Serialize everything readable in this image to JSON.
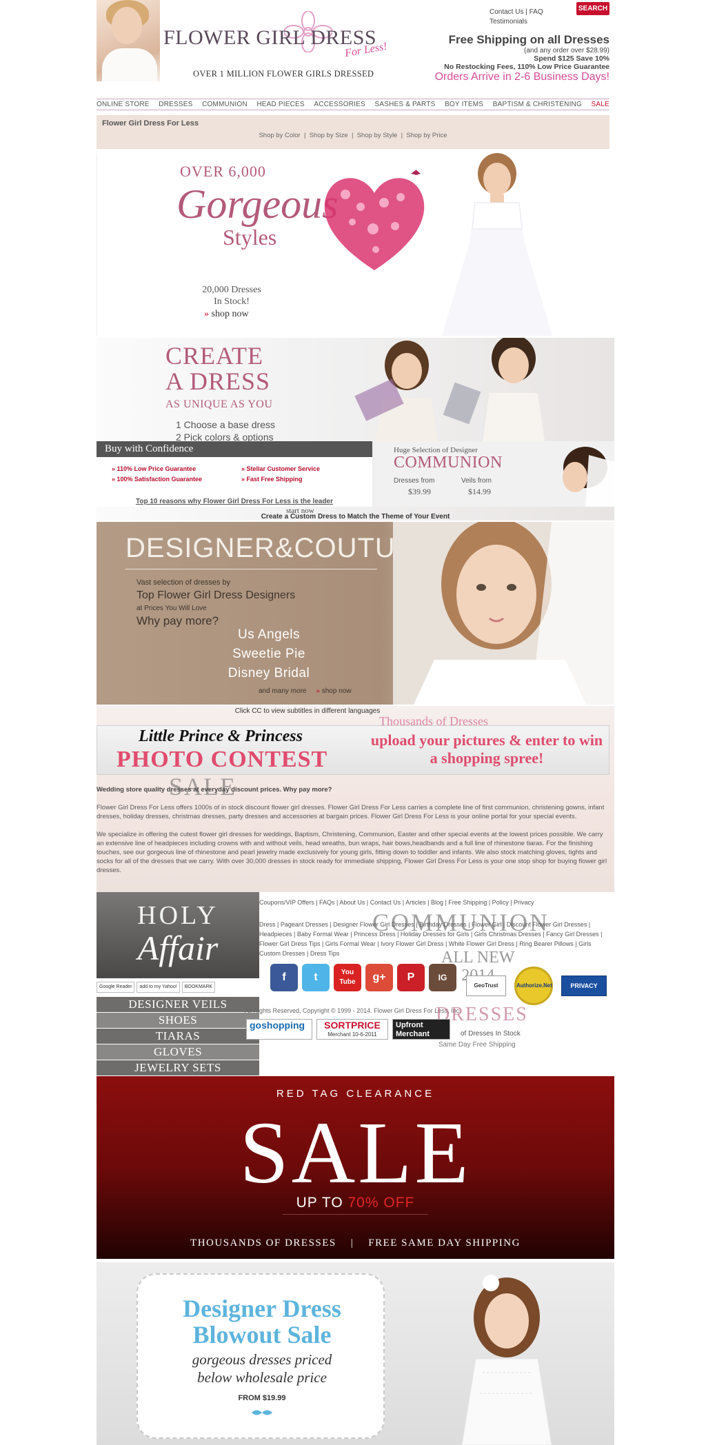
{
  "header": {
    "logo_main": "FLOWER GIRL DRESS",
    "logo_sub": "For Less!",
    "tagline": "OVER 1 MILLION FLOWER GIRLS DRESSED",
    "top_links": [
      "Contact Us",
      "FAQ",
      "Testimonials"
    ],
    "search_label": "SEARCH",
    "promo_line1": "Free Shipping on all Dresses",
    "promo_line2": "(and any order over $28.99)",
    "promo_line3": "Spend $125 Save 10%",
    "promo_line4": "No Restocking Fees, 110% Low Price Guarantee",
    "promo_line5": "Orders Arrive in 2-6 Business Days!"
  },
  "nav": {
    "items": [
      "ONLINE STORE",
      "DRESSES",
      "COMMUNION",
      "HEAD PIECES",
      "ACCESSORIES",
      "SASHES & PARTS",
      "BOY ITEMS",
      "BAPTISM & CHRISTENING",
      "SALE"
    ]
  },
  "strip": {
    "title": "Flower Girl Dress For Less",
    "links": [
      "Shop by Color",
      "Shop by Size",
      "Shop by Style",
      "Shop by Price"
    ]
  },
  "banner_styles": {
    "over": "OVER 6,000",
    "gorgeous": "Gorgeous",
    "styles": "Styles",
    "stock_line1": "20,000 Dresses",
    "stock_line2": "In Stock!",
    "shop": "shop now"
  },
  "banner_create": {
    "line1": "CREATE",
    "line2": "A DRESS",
    "unique": "AS UNIQUE AS YOU",
    "step1": "1  Choose a base dress",
    "step2": "2  Pick colors & options",
    "start": "start now",
    "caption": "Create a Custom Dress to Match the Theme of Your Event"
  },
  "confidence": {
    "title": "Buy with Confidence",
    "items": [
      "110% Low Price Guarantee",
      "Stellar Customer Service",
      "100% Satisfaction Guarantee",
      "Fast Free Shipping"
    ],
    "top10": "Top 10 reasons why Flower Girl Dress For Less is the leader"
  },
  "communion": {
    "huge": "Huge Selection of Designer",
    "title": "COMMUNION",
    "dresses_label": "Dresses from",
    "dresses_price": "$39.99",
    "veils_label": "Veils from",
    "veils_price": "$14.99"
  },
  "banner_designer": {
    "title": "DESIGNER&COUTURE",
    "vast": "Vast selection of dresses by",
    "top": "Top Flower Girl Dress Designers",
    "prices": "at Prices You Will Love",
    "why": "Why pay more?",
    "brands": [
      "Us Angels",
      "Sweetie Pie",
      "Disney Bridal"
    ],
    "more": "and many more",
    "shop": "shop now"
  },
  "banner_contest": {
    "cc": "Click CC to view subtitles in different languages",
    "thousands": "Thousands of Dresses",
    "lp": "Little Prince & Princess",
    "pc": "PHOTO CONTEST",
    "upload": "upload your pictures & enter to win a shopping spree!",
    "sale_ghost": "SALE"
  },
  "about": {
    "question": "Wedding store quality dresses at everyday discount prices. Why pay more?",
    "para1": "Flower Girl Dress For Less offers 1000s of in stock discount flower girl dresses. Flower Girl Dress For Less carries a complete line of first communion, christening gowns, infant dresses, holiday dresses, christmas dresses, party dresses and accessories at bargain prices. Flower Girl Dress For Less is your online portal for your special events.",
    "para2": "We specialize in offering the cutest flower girl dresses for weddings, Baptism, Christening, Communion, Easter and other special events at the lowest prices possible. We carry an extensive line of headpieces including crowns with and without veils, head wreaths, bun wraps, hair bows,headbands and a full line of rhinestone tiaras. For the finishing touches, see our gorgeous line of rhinestone and pearl jewelry made exclusively for young girls, fitting down to toddler and infants. We also stock matching gloves, tights and socks for all of the dresses that we carry. With over 30,000 dresses in stock ready for immediate shipping, Flower Girl Dress For Less is your one stop shop for buying flower girl dresses."
  },
  "holy": {
    "line1": "HOLY",
    "line2": "Affair",
    "bookmarks": [
      "Google Reader",
      "add to my Yahoo!",
      "BOOKMARK"
    ],
    "menu": [
      "DESIGNER VEILS",
      "SHOES",
      "TIARAS",
      "GLOVES",
      "JEWELRY SETS"
    ]
  },
  "footer": {
    "links1": "Coupons/VIP Offers  |  FAQs  |  About Us  |  Contact Us  |  Articles  |  Blog  |  Free Shipping  |  Policy  |  Privacy",
    "links2": "Dress  |  Pageant Dresses  |  Designer Flower Girl Dresses  |  Birthday Dresses  |  Flower Girl  |  Discount Flower Girl Dresses  |  Headpieces  |  Baby Formal Wear  |  Princess Dress  |  Holiday Dresses for Girls  |  Girls Christmas Dresses  |  Fancy Girl Dresses  |  Flower Girl Dress Tips  |  Girls Formal Wear  |  Ivory Flower Girl Dress  |  White Flower Girl Dress  |  Ring Bearer Pillows  |  Girls Custom Dresses  |  Dress Tips",
    "communion_ghost": "COMMUNION",
    "new_ghost1": "ALL NEW",
    "new_ghost2": "2014",
    "dresses_ghost": "DRESSES",
    "social": [
      "f",
      "t",
      "You Tube",
      "g+",
      "P",
      "IG"
    ],
    "seals": [
      "GeoTrust",
      "Authorize.Net",
      "PRIVACY"
    ],
    "copyright": "All Rights Reserved, Copyright © 1999 - 2014. Flower Girl Dress For Less, Inc.",
    "merchants": [
      "goshopping",
      "SORTPRICE",
      "Upfront Merchant"
    ],
    "merchant_sub": "Merchant 10-6-2011",
    "dresses_stock": "of Dresses In Stock",
    "sameday": "Same Day Free Shipping"
  },
  "sale_banner": {
    "rtc": "RED TAG CLEARANCE",
    "big": "SALE",
    "upto": "UP TO",
    "pct": "70% OFF",
    "bottom": "THOUSANDS OF DRESSES    |    FREE SAME DAY SHIPPING"
  },
  "blowout": {
    "line1": "Designer Dress",
    "line2": "Blowout Sale",
    "line3": "gorgeous dresses priced",
    "line4": "below wholesale price",
    "from": "FROM $19.99"
  },
  "colors": {
    "accent_pink": "#d64a96",
    "mauve": "#b35a7a",
    "sale_red": "#c8102e",
    "sky": "#5db4dc"
  }
}
